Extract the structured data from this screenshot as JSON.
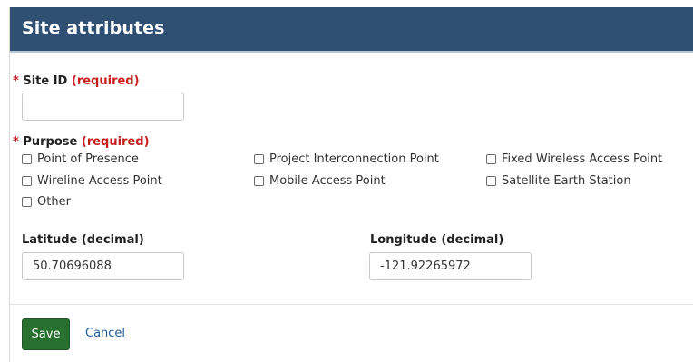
{
  "header": {
    "title": "Site attributes"
  },
  "site_id": {
    "label": "Site ID",
    "required_marker": "*",
    "required_text": "(required)",
    "value": ""
  },
  "purpose": {
    "label": "Purpose",
    "required_marker": "*",
    "required_text": "(required)",
    "options": [
      {
        "label": "Point of Presence",
        "checked": false
      },
      {
        "label": "Project Interconnection Point",
        "checked": false
      },
      {
        "label": "Fixed Wireless Access Point",
        "checked": false
      },
      {
        "label": "Wireline Access Point",
        "checked": false
      },
      {
        "label": "Mobile Access Point",
        "checked": false
      },
      {
        "label": "Satellite Earth Station",
        "checked": false
      },
      {
        "label": "Other",
        "checked": false
      }
    ]
  },
  "latitude": {
    "label": "Latitude (decimal)",
    "value": "50.70696088"
  },
  "longitude": {
    "label": "Longitude (decimal)",
    "value": "-121.92265972"
  },
  "actions": {
    "save_label": "Save",
    "cancel_label": "Cancel"
  },
  "colors": {
    "header_bg": "#2f4f73",
    "required": "#c81e1e",
    "save_bg": "#27702f",
    "link": "#1d5c99"
  }
}
